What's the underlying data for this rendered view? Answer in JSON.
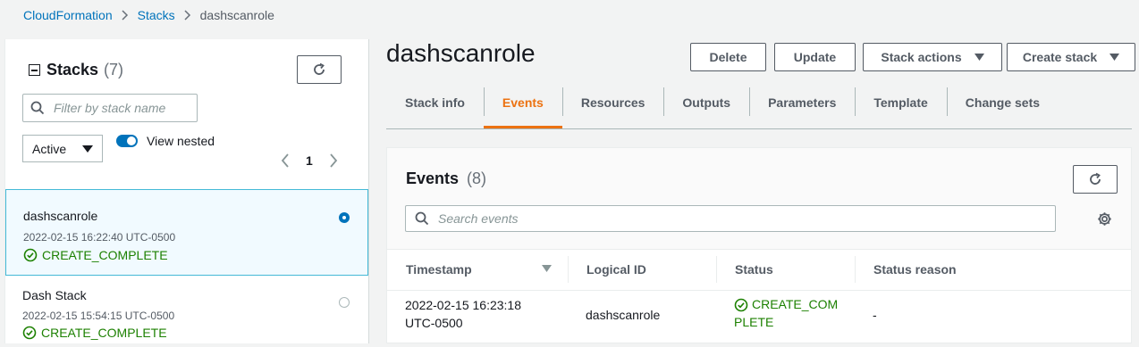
{
  "breadcrumb": {
    "items": [
      "CloudFormation",
      "Stacks"
    ],
    "current": "dashscanrole"
  },
  "stacks_panel": {
    "title": "Stacks",
    "count": "(7)",
    "filter_placeholder": "Filter by stack name",
    "status_filter": "Active",
    "view_nested_label": "View nested",
    "page": "1",
    "items": [
      {
        "name": "dashscanrole",
        "date": "2022-02-15 16:22:40 UTC-0500",
        "status": "CREATE_COMPLETE",
        "selected": true
      },
      {
        "name": "Dash Stack",
        "date": "2022-02-15 15:54:15 UTC-0500",
        "status": "CREATE_COMPLETE",
        "selected": false
      }
    ]
  },
  "stack": {
    "title": "dashscanrole",
    "actions": {
      "delete": "Delete",
      "update": "Update",
      "stack_actions": "Stack actions",
      "create_stack": "Create stack"
    }
  },
  "tabs": [
    "Stack info",
    "Events",
    "Resources",
    "Outputs",
    "Parameters",
    "Template",
    "Change sets"
  ],
  "active_tab": "Events",
  "events": {
    "title": "Events",
    "count": "(8)",
    "search_placeholder": "Search events",
    "columns": [
      "Timestamp",
      "Logical ID",
      "Status",
      "Status reason"
    ],
    "rows": [
      {
        "timestamp_line1": "2022-02-15 16:23:18",
        "timestamp_line2": "UTC-0500",
        "logical_id": "dashscanrole",
        "status_line1": "CREATE_COM",
        "status_line2": "PLETE",
        "reason": "-"
      }
    ]
  },
  "colors": {
    "link": "#0073bb",
    "active_tab": "#ec7211",
    "success": "#1d8102",
    "selected_bg": "#f1faff"
  }
}
